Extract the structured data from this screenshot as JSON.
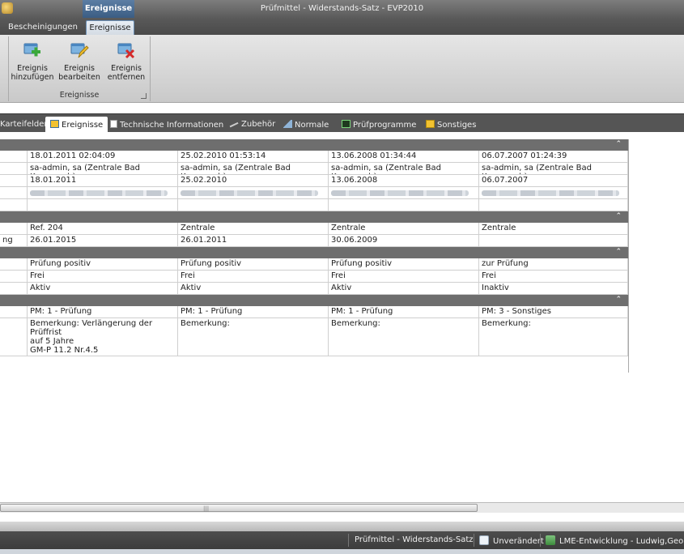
{
  "titlebar": {
    "context_tab": "Ereignisse",
    "title": "Prüfmittel - Widerstands-Satz - EVP2010"
  },
  "ribbon_tabs": [
    "Bescheinigungen",
    "Ereignisse"
  ],
  "ribbon": {
    "group_label": "Ereignisse",
    "buttons": [
      {
        "label": "Ereignis\nhinzufügen",
        "icon": "event-add-icon"
      },
      {
        "label": "Ereignis\nbearbeiten",
        "icon": "event-edit-icon"
      },
      {
        "label": "Ereignis\nentfernen",
        "icon": "event-remove-icon"
      }
    ]
  },
  "doc_tabs": [
    {
      "label": "Karteifelder"
    },
    {
      "label": "Ereignisse",
      "icon": "event-tab-icon"
    },
    {
      "label": "Technische Informationen",
      "icon": "document-icon"
    },
    {
      "label": "Zubehör",
      "icon": "accessory-icon"
    },
    {
      "label": "Normale",
      "icon": "normal-icon"
    },
    {
      "label": "Prüfprogramme",
      "icon": "program-icon"
    },
    {
      "label": "Sonstiges",
      "icon": "folder-icon"
    }
  ],
  "grid": {
    "section1": {
      "rows": [
        {
          "label": "",
          "cells": [
            "18.01.2011 02:04:09",
            "25.02.2010 01:53:14",
            "13.06.2008 01:34:44",
            "06.07.2007 01:24:39"
          ]
        },
        {
          "label": "",
          "cells": [
            "sa-admin, sa (Zentrale Bad Kreuznach)",
            "sa-admin, sa (Zentrale Bad Kreuznach)",
            "sa-admin, sa (Zentrale Bad Kreuznach)",
            "sa-admin, sa (Zentrale Bad Kreuznach)"
          ]
        },
        {
          "label": "",
          "cells": [
            "18.01.2011",
            "25.02.2010",
            "13.06.2008",
            "06.07.2007"
          ]
        }
      ]
    },
    "section2": {
      "rows": [
        {
          "label": "",
          "cells": [
            "Ref. 204",
            "Zentrale",
            "Zentrale",
            "Zentrale"
          ]
        },
        {
          "label": "ng",
          "cells": [
            "26.01.2015",
            "26.01.2011",
            "30.06.2009",
            ""
          ]
        }
      ]
    },
    "section3": {
      "rows": [
        {
          "label": "",
          "cells": [
            "Prüfung positiv",
            "Prüfung positiv",
            "Prüfung positiv",
            "zur Prüfung"
          ]
        },
        {
          "label": "",
          "cells": [
            "Frei",
            "Frei",
            "Frei",
            "Frei"
          ]
        },
        {
          "label": "",
          "cells": [
            "Aktiv",
            "Aktiv",
            "Aktiv",
            "Inaktiv"
          ]
        }
      ]
    },
    "section4": {
      "rows": [
        {
          "label": "",
          "cells": [
            "PM: 1 - Prüfung",
            "PM: 1 - Prüfung",
            "PM: 1 - Prüfung",
            "PM: 3 - Sonstiges"
          ]
        },
        {
          "label": "",
          "cells": [
            "Bemerkung: Verlängerung der Prüffrist\nauf 5 Jahre\nGM-P 11.2 Nr.4.5",
            "Bemerkung:",
            "Bemerkung:",
            "Bemerkung:"
          ]
        }
      ]
    }
  },
  "statusbar": {
    "item1": "Prüfmittel - Widerstands-Satz",
    "item2": "Unverändert",
    "item3": "LME-Entwicklung - Ludwig,Georg"
  },
  "colors": {
    "section_header": "#6e6e6e",
    "accent": "#3b5d83",
    "statusbar": "#444444"
  }
}
